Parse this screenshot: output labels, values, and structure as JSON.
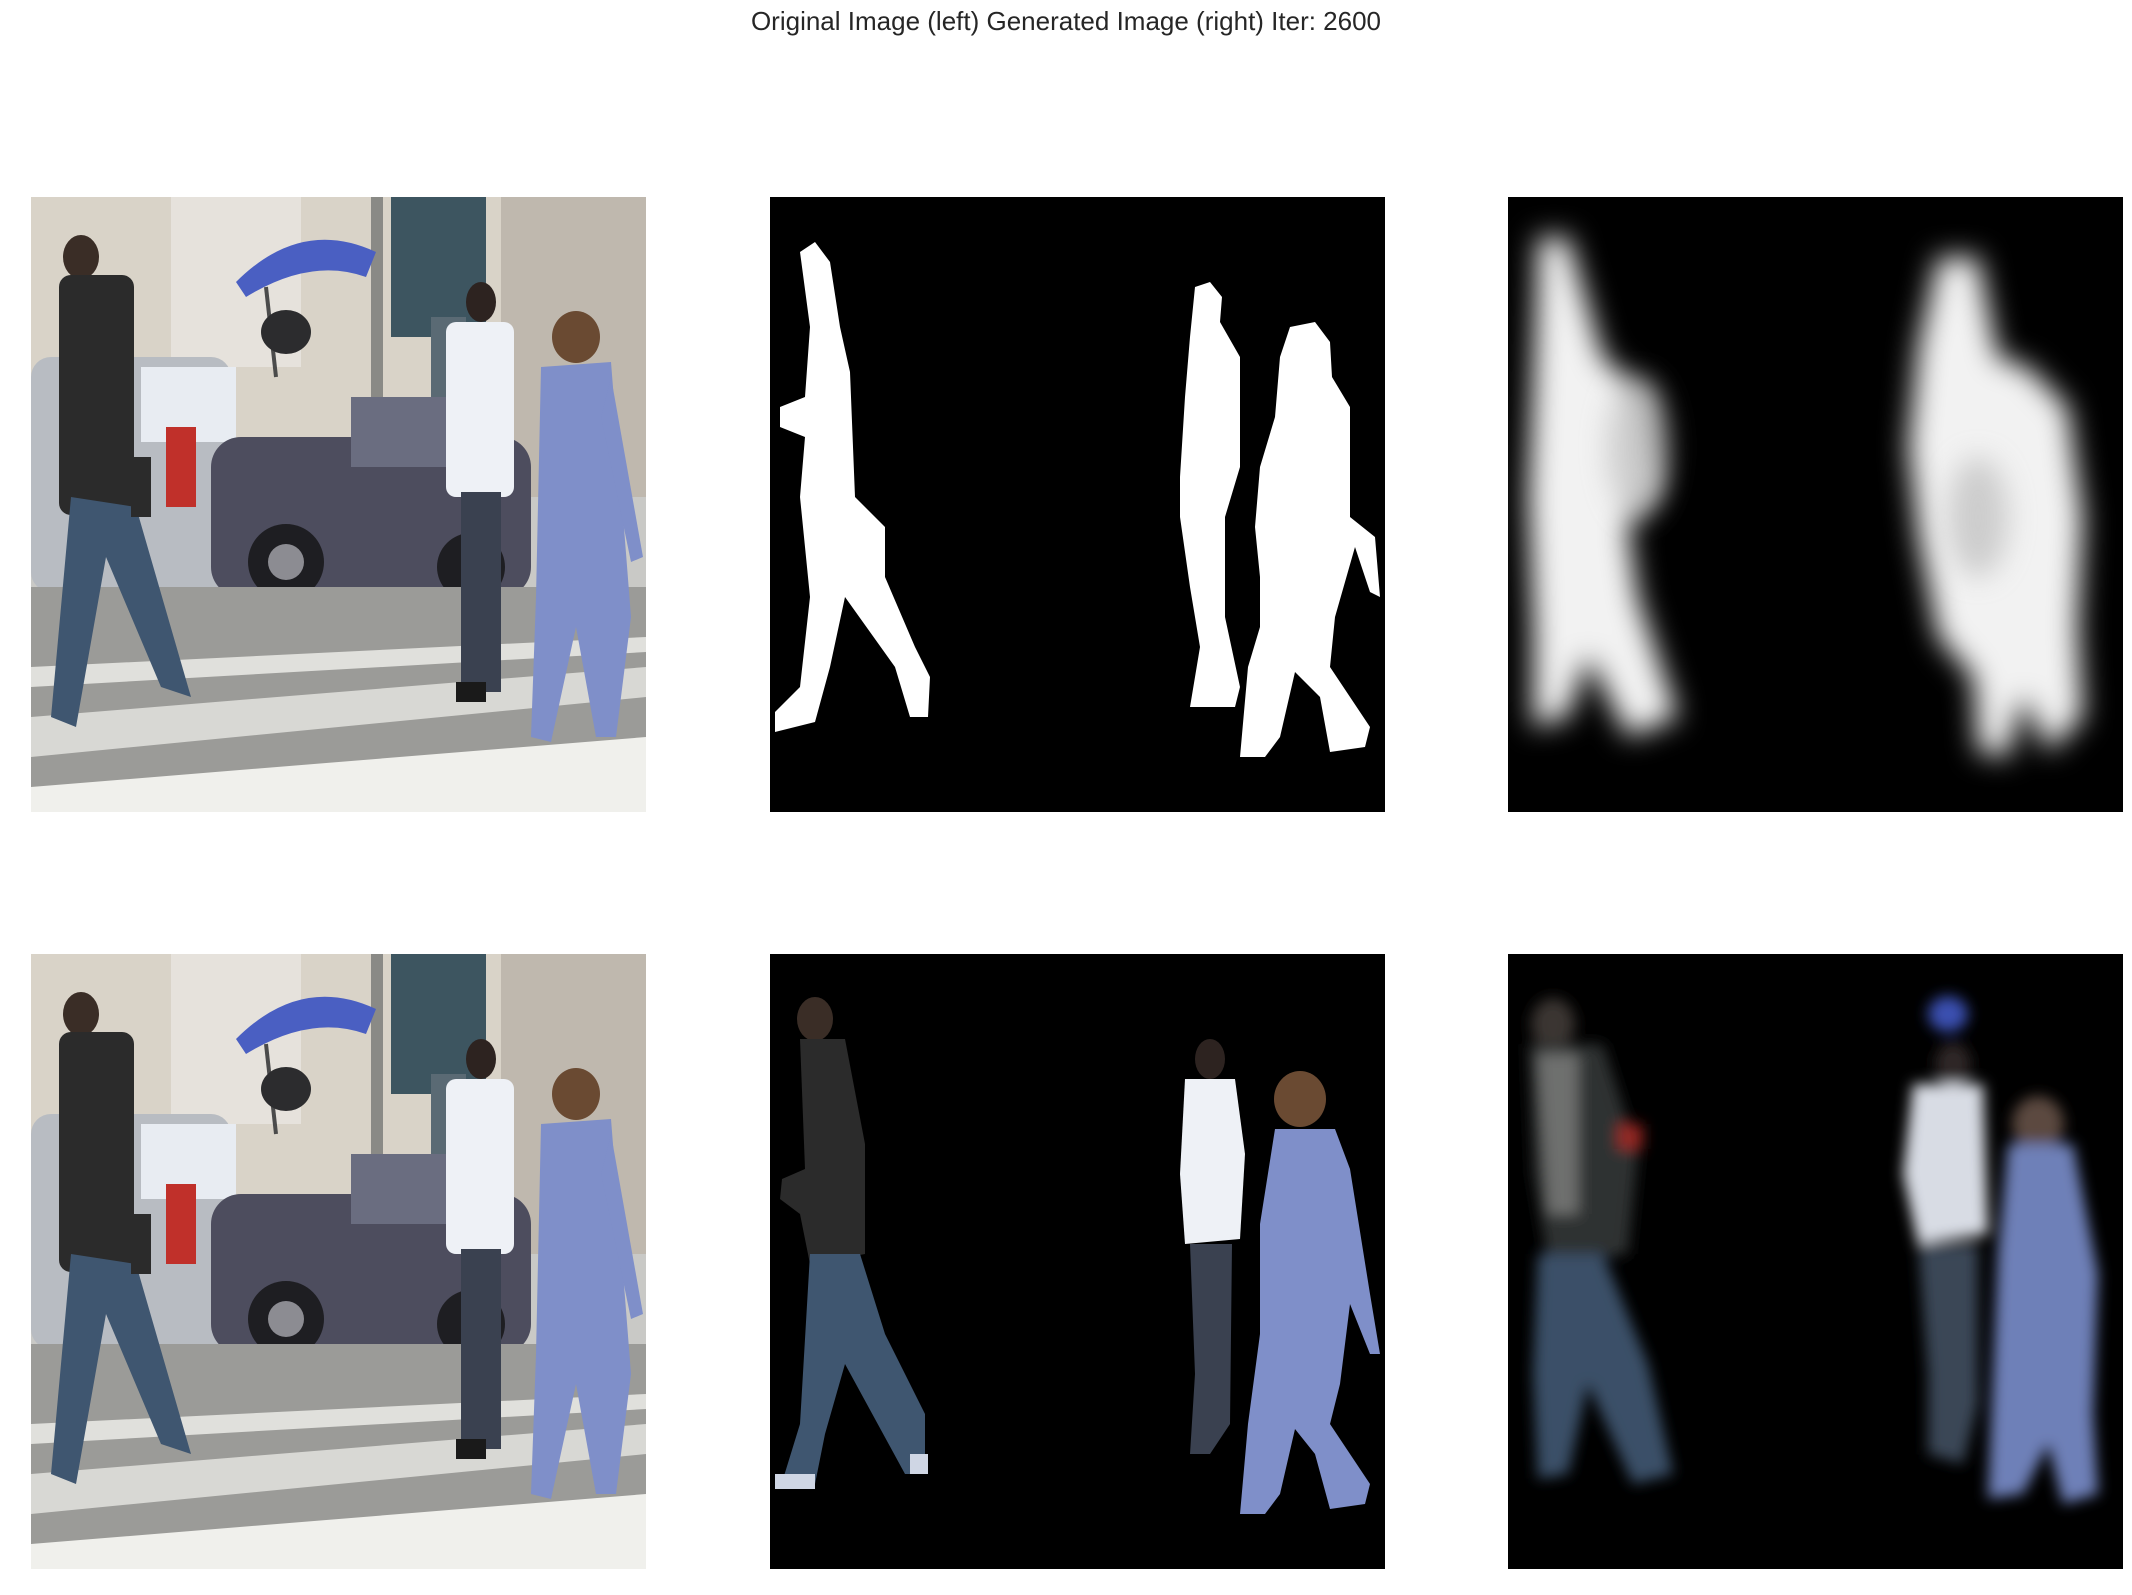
{
  "figure": {
    "title": "Original Image (left) Generated Image (right) Iter: 2600"
  },
  "panels": [
    {
      "row": 1,
      "col": 1,
      "content": "street scene with pedestrians"
    },
    {
      "row": 1,
      "col": 2,
      "content": "ground-truth binary mask"
    },
    {
      "row": 1,
      "col": 3,
      "content": "predicted blurry mask"
    },
    {
      "row": 2,
      "col": 1,
      "content": "street scene with pedestrians"
    },
    {
      "row": 2,
      "col": 2,
      "content": "ground-truth masked pedestrians"
    },
    {
      "row": 2,
      "col": 3,
      "content": "predicted masked pedestrians"
    }
  ],
  "colors": {
    "background": "#ffffff",
    "mask_fill": "#ffffff",
    "mask_bg": "#000000",
    "jeans": "#3f5670",
    "blue_outfit": "#7f8fc9",
    "umbrella": "#4a5fc2",
    "shirt_dark": "#2b2b2b"
  }
}
